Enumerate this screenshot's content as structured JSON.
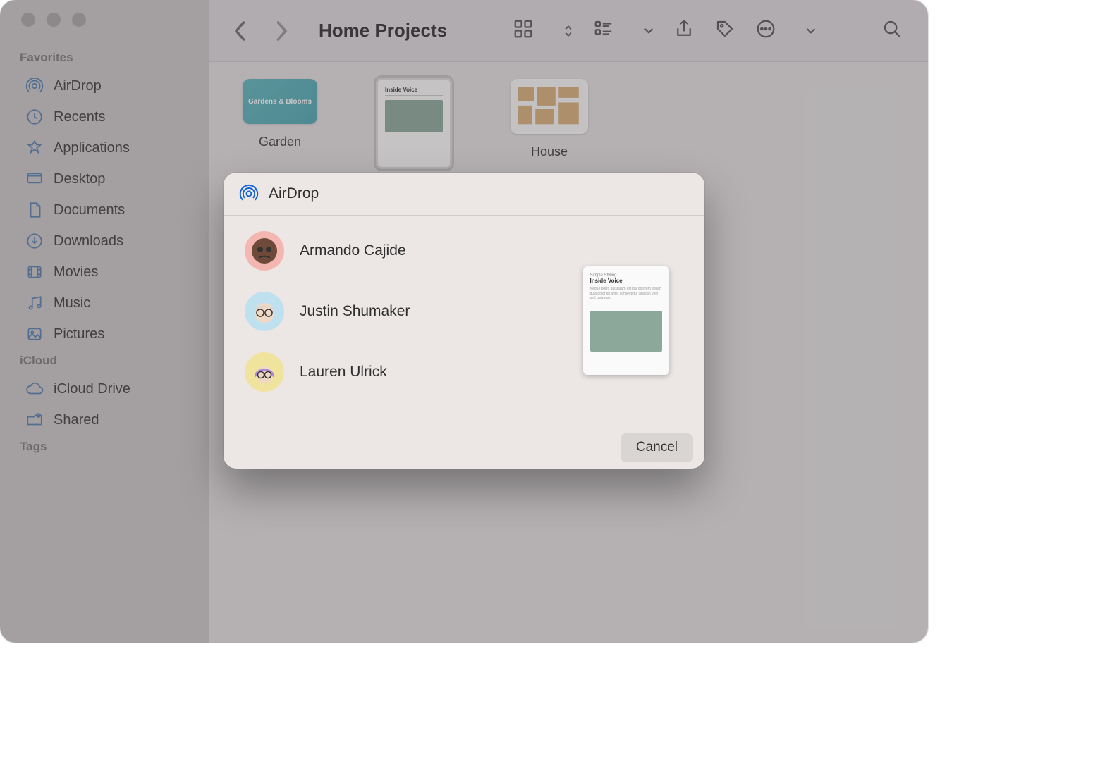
{
  "window": {
    "title": "Home Projects"
  },
  "sidebar": {
    "sections": [
      {
        "label": "Favorites",
        "items": [
          {
            "label": "AirDrop",
            "icon": "airdrop"
          },
          {
            "label": "Recents",
            "icon": "clock"
          },
          {
            "label": "Applications",
            "icon": "app"
          },
          {
            "label": "Desktop",
            "icon": "desktop"
          },
          {
            "label": "Documents",
            "icon": "doc"
          },
          {
            "label": "Downloads",
            "icon": "download"
          },
          {
            "label": "Movies",
            "icon": "movie"
          },
          {
            "label": "Music",
            "icon": "music"
          },
          {
            "label": "Pictures",
            "icon": "picture"
          }
        ]
      },
      {
        "label": "iCloud",
        "items": [
          {
            "label": "iCloud Drive",
            "icon": "cloud"
          },
          {
            "label": "Shared",
            "icon": "shared"
          }
        ]
      },
      {
        "label": "Tags",
        "items": []
      }
    ]
  },
  "files": [
    {
      "name": "Garden",
      "selected": false,
      "kind": "card",
      "card_text": "Gardens & Blooms"
    },
    {
      "name": "Simple Styling",
      "selected": true,
      "kind": "doc",
      "doc_heading": "Inside Voice"
    },
    {
      "name": "House",
      "selected": false,
      "kind": "plan"
    }
  ],
  "sheet": {
    "title": "AirDrop",
    "people": [
      {
        "name": "Armando Cajide",
        "avatar_bg": "#f3b6b1"
      },
      {
        "name": "Justin Shumaker",
        "avatar_bg": "#bfe0ef"
      },
      {
        "name": "Lauren Ulrick",
        "avatar_bg": "#f0e39d"
      }
    ],
    "preview_heading": "Inside Voice",
    "cancel_label": "Cancel"
  }
}
